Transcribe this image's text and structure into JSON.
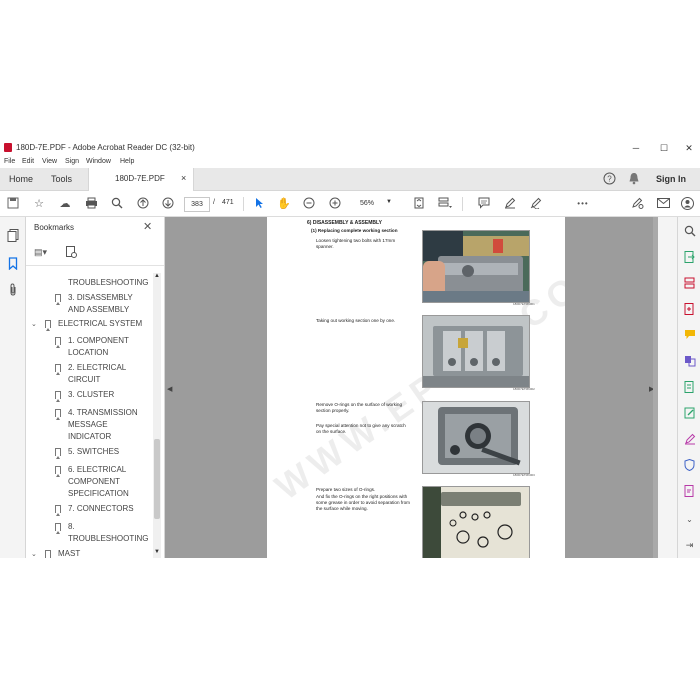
{
  "window": {
    "title": "180D-7E.PDF - Adobe Acrobat Reader DC (32-bit)",
    "minimize": "─",
    "maximize": "☐",
    "close": "✕"
  },
  "menu": [
    "File",
    "Edit",
    "View",
    "Sign",
    "Window",
    "Help"
  ],
  "tabs": {
    "home": "Home",
    "tools": "Tools",
    "document": "180D-7E.PDF",
    "sign_in": "Sign In"
  },
  "toolbar": {
    "page_current": "383",
    "page_separator": "/",
    "page_total": "471",
    "zoom": "56%",
    "more": "•••"
  },
  "bookmarks": {
    "title": "Bookmarks",
    "items": [
      {
        "label": "TROUBLESHOOTING"
      },
      {
        "label": "3. DISASSEMBLY AND ASSEMBLY"
      },
      {
        "label": "ELECTRICAL SYSTEM"
      },
      {
        "label": "1. COMPONENT LOCATION"
      },
      {
        "label": "2. ELECTRICAL CIRCUIT"
      },
      {
        "label": "3. CLUSTER"
      },
      {
        "label": "4. TRANSMISSION MESSAGE INDICATOR"
      },
      {
        "label": "5. SWITCHES"
      },
      {
        "label": "6. ELECTRICAL COMPONENT SPECIFICATION"
      },
      {
        "label": "7. CONNECTORS"
      },
      {
        "label": "8. TROUBLESHOOTING"
      },
      {
        "label": "MAST"
      }
    ]
  },
  "page": {
    "heading": "6) DISASSEMBLY & ASSEMBLY",
    "subheading": "(1) Replacing complete working section",
    "steps": [
      {
        "text": "Loosen tightening two bolts with 17mm spanner.",
        "code": "180D7ETM6001"
      },
      {
        "text": "Taking out working section one by one.",
        "code": "180D7ETM6002"
      },
      {
        "text": "Remove O-rings on the surface of working section properly.",
        "text2": "Pay special attention not to give any scratch on the surface.",
        "code": "180D7ETM6003"
      },
      {
        "text": "Prepare two sizes of O-rings.",
        "text2": "And fix the O-rings on the right positions with some grease in order to avoid separation from the surface while moving.",
        "code": ""
      }
    ],
    "watermark": "WWW.EPCDF.COM"
  },
  "colors": {
    "accent": "#1473e6",
    "acrobat_red": "#c8102e",
    "doc_bg": "#9c9c9c"
  }
}
